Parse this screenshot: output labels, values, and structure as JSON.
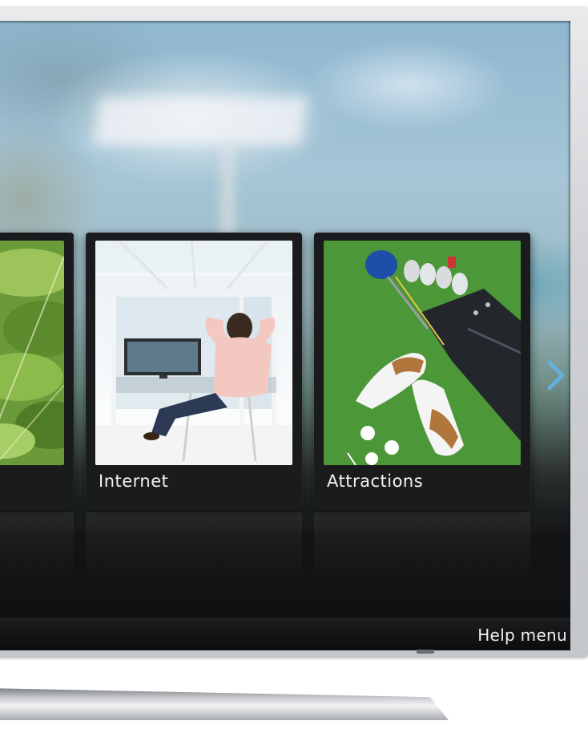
{
  "tiles": [
    {
      "label": "",
      "thumb": "green-leaves-image"
    },
    {
      "label": "Internet",
      "thumb": "man-relaxing-watching-tv-image"
    },
    {
      "label": "Attractions",
      "thumb": "golf-shoes-and-bag-image"
    }
  ],
  "footer": {
    "help_label": "Help menu"
  },
  "icons": {
    "next": "chevron-right-icon"
  },
  "colors": {
    "accent": "#5fb4e6",
    "tile_bg": "#1a1b1d",
    "text": "#f2f2f2"
  }
}
